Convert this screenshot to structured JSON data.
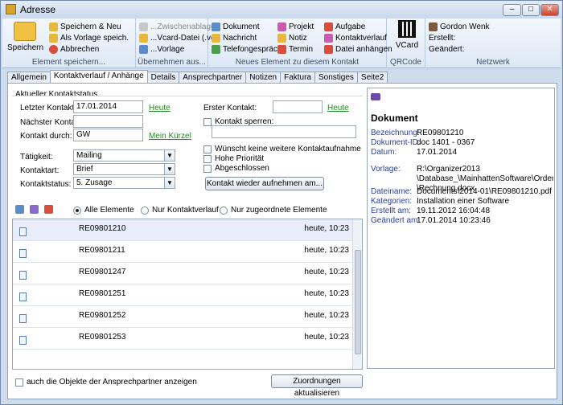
{
  "window": {
    "title": "Adresse",
    "min": "–",
    "max": "□",
    "close": "✕"
  },
  "ribbon": {
    "g1": {
      "big": "Speichern",
      "items": [
        "Speichern & Neu",
        "Als Vorlage speich.",
        "Abbrechen"
      ],
      "label": "Element speichern..."
    },
    "g2": {
      "items": [
        "...Zwischenablage",
        "...Vcard-Datei (.vcf)",
        "...Vorlage"
      ],
      "label": "Übernehmen aus..."
    },
    "g3": {
      "col1": [
        "Dokument",
        "Nachricht",
        "Telefongespräch"
      ],
      "col2": [
        "Projekt",
        "Notiz",
        "Termin"
      ],
      "col3": [
        "Aufgabe",
        "Kontaktverlauf",
        "Datei anhängen"
      ],
      "label": "Neues Element zu diesem Kontakt"
    },
    "g4": {
      "big": "VCard",
      "label": "QRCode"
    },
    "g5": {
      "user": "Gordon Wenk",
      "created": "Erstellt:",
      "changed": "Geändert:",
      "label": "Netzwerk"
    }
  },
  "tabs": [
    "Allgemein",
    "Kontaktverlauf / Anhänge",
    "Details",
    "Ansprechpartner",
    "Notizen",
    "Faktura",
    "Sonstiges",
    "Seite2"
  ],
  "form": {
    "section": "Aktueller Kontaktstatus",
    "last_label": "Letzter Kontakt:",
    "last_value": "17.01.2014",
    "today1": "Heute",
    "next_label": "Nächster Kontakt:",
    "next_value": "",
    "by_label": "Kontakt durch:",
    "by_value": "GW",
    "shortcut": "Mein Kürzel",
    "first_label": "Erster Kontakt:",
    "first_value": "",
    "today2": "Heute",
    "lock": "Kontakt sperren:",
    "lock_value": "",
    "activity_label": "Tätigkeit:",
    "activity_value": "Mailing",
    "kind_label": "Kontaktart:",
    "kind_value": "Brief",
    "status_label": "Kontaktstatus:",
    "status_value": "5. Zusage",
    "no_more": "Wünscht keine weitere Kontaktaufnahme",
    "priority": "Hohe Priorität",
    "closed": "Abgeschlossen",
    "resume": "Kontakt wieder aufnehmen am...",
    "arrow": "▼"
  },
  "filter": {
    "all": "Alle Elemente",
    "history": "Nur Kontaktverlauf",
    "assigned": "Nur zugeordnete Elemente"
  },
  "rows": [
    {
      "name": "RE09801210",
      "time": "heute, 10:23"
    },
    {
      "name": "RE09801211",
      "time": "heute, 10:23"
    },
    {
      "name": "RE09801247",
      "time": "heute, 10:23"
    },
    {
      "name": "RE09801251",
      "time": "heute, 10:23"
    },
    {
      "name": "RE09801252",
      "time": "heute, 10:23"
    },
    {
      "name": "RE09801253",
      "time": "heute, 10:23"
    }
  ],
  "bottom": {
    "check": "auch die Objekte der Ansprechpartner anzeigen",
    "refresh": "Zuordnungen aktualisieren"
  },
  "preview": {
    "title": "Dokument",
    "rows": [
      {
        "k": "Bezeichnung:",
        "v": "RE09801210"
      },
      {
        "k": "Dokument-ID:",
        "v": "doc 1401 - 0367"
      },
      {
        "k": "Datum:",
        "v": "17.01.2014"
      },
      {
        "k": "Vorlage:",
        "v": "R:\\Organizer2013"
      },
      {
        "k": "",
        "v": "\\Database_\\MainhattenSoftware\\Order\\D"
      },
      {
        "k": "",
        "v": "\\Rechnung.docx"
      },
      {
        "k": "Dateiname:",
        "v": "Documents\\2014-01\\RE09801210.pdf"
      },
      {
        "k": "Kategorien:",
        "v": "Installation einer Software"
      },
      {
        "k": "Erstellt am:",
        "v": "19.11.2012 16:04:48"
      },
      {
        "k": "Geändert am:",
        "v": "17.01.2014 10:23:46"
      }
    ]
  }
}
